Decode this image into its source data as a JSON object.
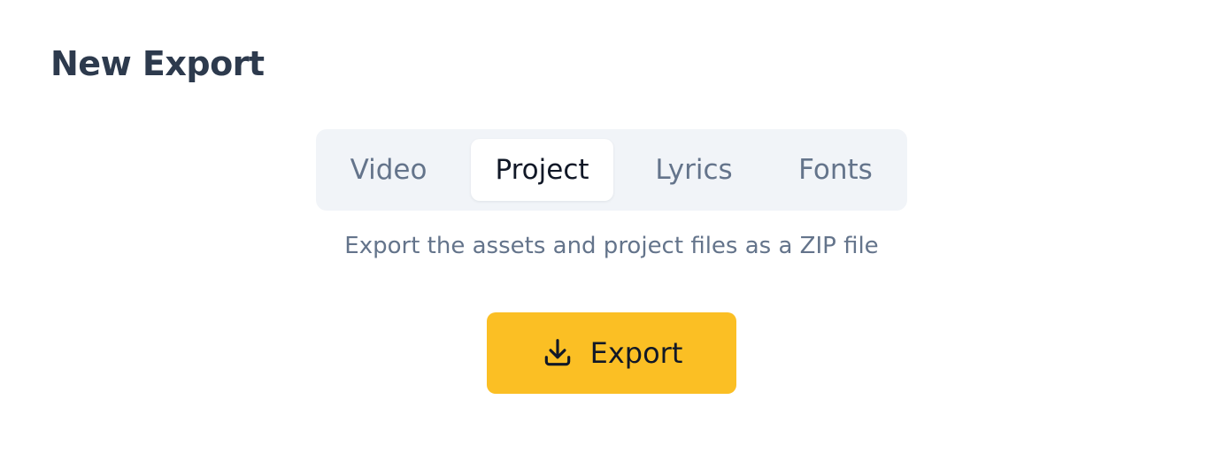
{
  "header": {
    "title": "New Export"
  },
  "tabs": [
    {
      "label": "Video",
      "active": false
    },
    {
      "label": "Project",
      "active": true
    },
    {
      "label": "Lyrics",
      "active": false
    },
    {
      "label": "Fonts",
      "active": false
    }
  ],
  "description": "Export the assets and project files as a ZIP file",
  "export_button": {
    "label": "Export",
    "icon": "download-icon",
    "color": "#fbbf24"
  },
  "colors": {
    "title": "#2d3a4d",
    "tab_bar_background": "#f1f4f8",
    "tab_inactive_text": "#64748b",
    "tab_active_text": "#111827",
    "accent": "#fbbf24"
  }
}
